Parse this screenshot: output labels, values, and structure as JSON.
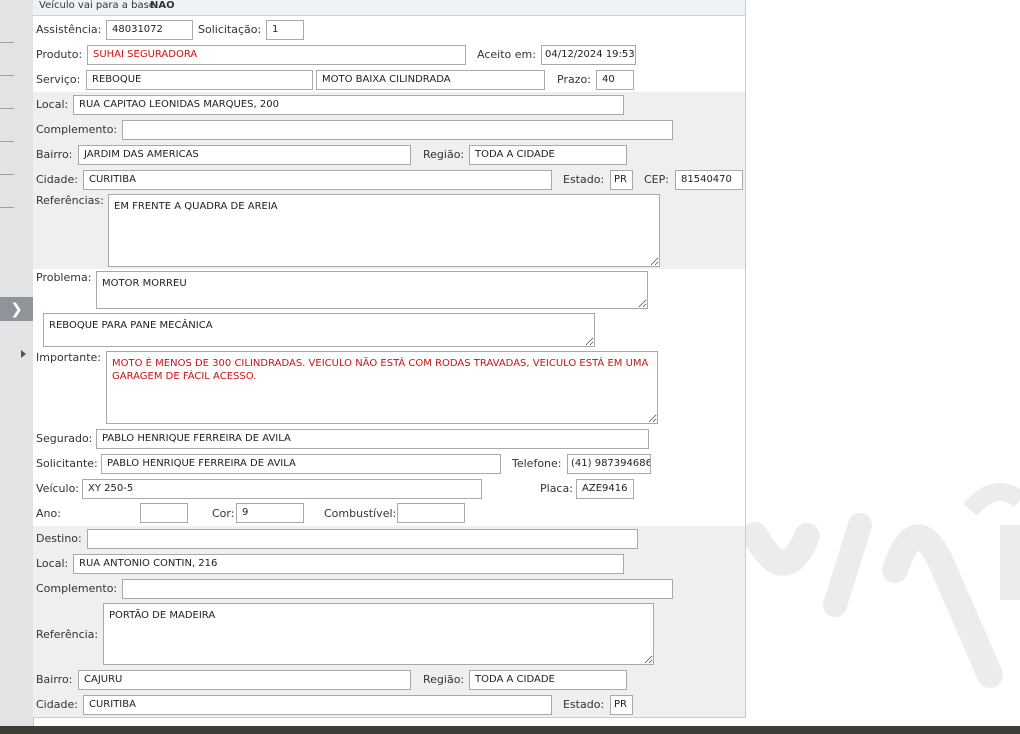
{
  "top": {
    "label": "Veículo vai para a base:",
    "value": "NAO"
  },
  "labels": {
    "assistencia": "Assistência:",
    "solicitacao": "Solicitação:",
    "produto": "Produto:",
    "aceito": "Aceito em:",
    "servico": "Serviço:",
    "prazo": "Prazo:",
    "local": "Local:",
    "complemento": "Complemento:",
    "bairro": "Bairro:",
    "regiao": "Região:",
    "cidade": "Cidade:",
    "estado": "Estado:",
    "cep": "CEP:",
    "referencias": "Referências:",
    "problema": "Problema:",
    "importante": "Importante:",
    "segurado": "Segurado:",
    "solicitante": "Solicitante:",
    "telefone": "Telefone:",
    "veiculo": "Veículo:",
    "placa": "Placa:",
    "ano": "Ano:",
    "cor": "Cor:",
    "combustivel": "Combustível:",
    "destino": "Destino:",
    "referencia": "Referência:"
  },
  "origin": {
    "assistencia": "48031072",
    "solicitacao": "1",
    "produto": "SUHAI SEGURADORA",
    "aceito_em": "04/12/2024 19:53",
    "servico": "REBOQUE",
    "servico_tipo": "MOTO BAIXA CILINDRADA",
    "prazo": "40",
    "local": "RUA CAPITAO LEONIDAS MARQUES, 200",
    "complemento": "",
    "bairro": "JARDIM DAS AMERICAS",
    "regiao": "TODA A CIDADE",
    "cidade": "CURITIBA",
    "estado": "PR",
    "cep": "81540470",
    "referencias": "EM FRENTE A QUADRA DE AREIA",
    "problema": "MOTOR MORREU",
    "detalhe": "REBOQUE PARA PANE MECÂNICA",
    "importante": "MOTO É MENOS DE 300 CILINDRADAS. VEICULO NÃO ESTÁ COM RODAS TRAVADAS, VEICULO ESTÁ EM UMA GARAGEM DE FÁCIL ACESSO.",
    "segurado": "PABLO HENRIQUE FERREIRA DE AVILA",
    "solicitante": "PABLO HENRIQUE FERREIRA DE AVILA",
    "telefone": "(41) 987394686",
    "veiculo": "XY 250-5",
    "placa": "AZE9416",
    "ano": "",
    "cor": "9",
    "combustivel": ""
  },
  "destination": {
    "destino": "",
    "local": "RUA ANTONIO CONTIN, 216",
    "complemento": "",
    "referencia": "PORTÃO DE MADEIRA",
    "bairro": "CAJURU",
    "regiao": "TODA A CIDADE",
    "cidade": "CURITIBA",
    "estado": "PR"
  },
  "colors": {
    "accent_red": "#cc1111",
    "band_gray": "#efefef"
  },
  "sidebar": {
    "toggle_icon": "chevron-right-icon"
  }
}
